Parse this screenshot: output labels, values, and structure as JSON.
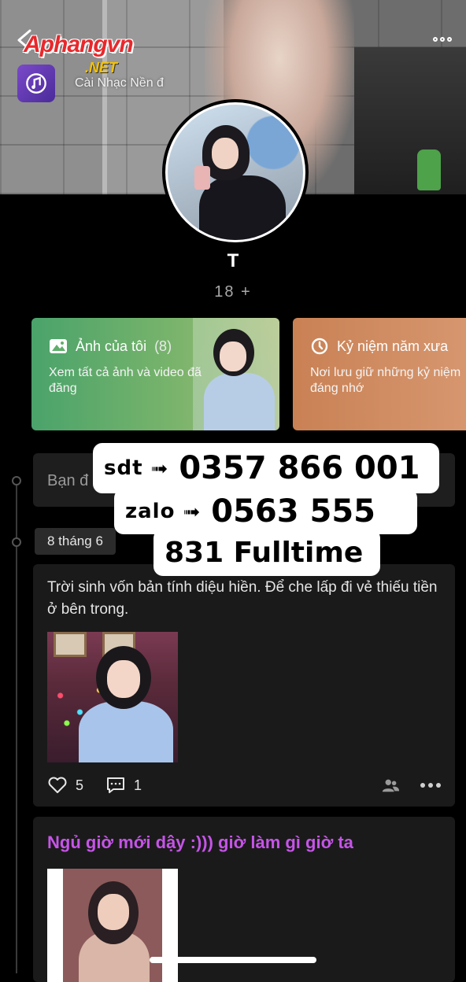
{
  "watermark": {
    "brand": "Aphangvn",
    "tld": ".NET"
  },
  "cover": {
    "music_label": "Cài Nhạc Nền đ"
  },
  "profile": {
    "name": "T",
    "subtitle": "18 +"
  },
  "cards": [
    {
      "title": "Ảnh của tôi",
      "count": "(8)",
      "desc": "Xem tất cả ảnh và video đã đăng"
    },
    {
      "title": "Kỷ niệm năm xưa",
      "desc": "Nơi lưu giữ những kỷ niệm đáng nhớ"
    }
  ],
  "status": {
    "placeholder": "Bạn đ"
  },
  "timeline": {
    "date": "8 tháng 6"
  },
  "banner": {
    "line1_label": "sdt",
    "line1_number": "0357 866 001",
    "line2_label": "zalo",
    "line2_number": "0563 555",
    "line3": "831 Fulltime"
  },
  "posts": [
    {
      "text": "Trời sinh vốn bản tính diệu hiền. Để che lấp đi vẻ thiếu tiền ở bên trong.",
      "likes": "5",
      "comments": "1"
    },
    {
      "text": "Ngủ giờ mới dậy :))) giờ làm gì giờ ta"
    }
  ],
  "icons": {
    "back": "chevron-left-icon",
    "menu": "more-icon",
    "music": "music-note-icon",
    "photos": "image-icon",
    "memories": "clock-history-icon",
    "like": "heart-icon",
    "comment": "comment-icon",
    "audience": "friends-icon",
    "more": "more-icon"
  },
  "colors": {
    "background": "#000000",
    "card_photos": "#5fae6b",
    "card_memories": "#d08a61",
    "post_title_accent": "#c654e8"
  }
}
